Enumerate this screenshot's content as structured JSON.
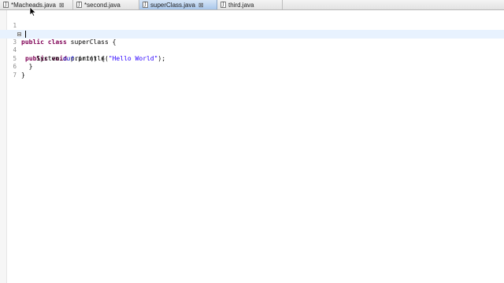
{
  "tabs": [
    {
      "label": "*Macheads.java",
      "icon": "java-file-icon",
      "closable": true,
      "active": false
    },
    {
      "label": "*second.java",
      "icon": "java-file-icon",
      "closable": false,
      "active": false
    },
    {
      "label": "superClass.java",
      "icon": "java-file-icon",
      "closable": true,
      "active": true
    },
    {
      "label": "third.java",
      "icon": "java-file-icon",
      "closable": false,
      "active": false
    }
  ],
  "file_icon_glyph": "J",
  "close_glyph": "⊠",
  "editor": {
    "line_numbers": [
      "1",
      "2",
      "3",
      "4",
      "5",
      "6",
      "7"
    ],
    "code": {
      "l2_kw1": "public",
      "l2_kw2": "class",
      "l2_rest": " superClass {",
      "l3_kw1": "public",
      "l3_kw2": "void",
      "l3_rest": " print() {",
      "l4_pre": "    System.",
      "l4_field": "out",
      "l4_mid": ".println(",
      "l4_str": "\"Hello World\"",
      "l4_end": ");",
      "l5": "  }",
      "l6": "}"
    },
    "current_line": 3
  },
  "colors": {
    "keyword": "#7f0055",
    "string": "#2a00ff",
    "field": "#0000c0",
    "current_line_bg": "#e8f2fe",
    "active_tab": "#a9c6ea"
  }
}
